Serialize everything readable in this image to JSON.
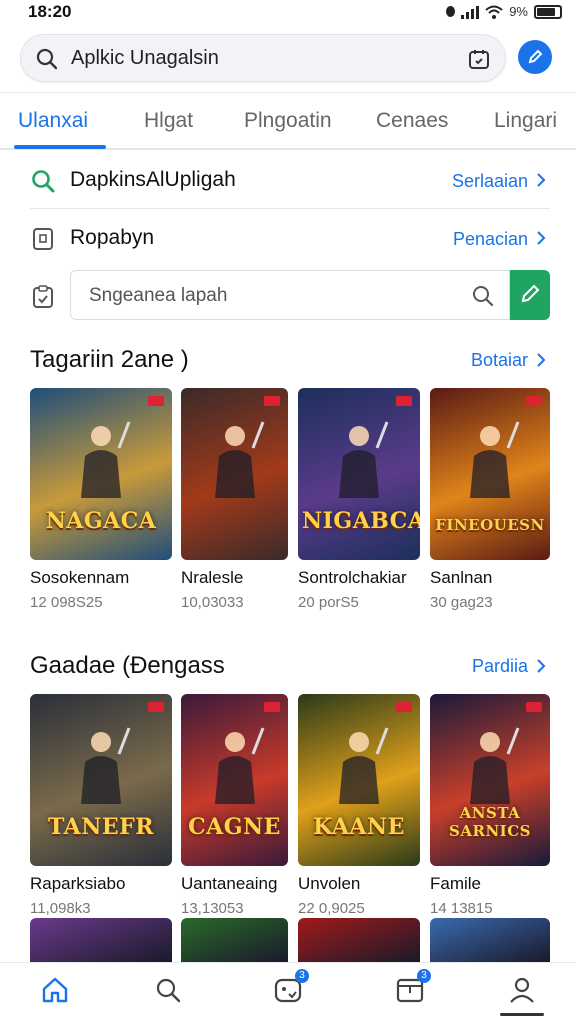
{
  "status_bar": {
    "time": "18:20",
    "battery": "9%"
  },
  "search": {
    "value": "Aplkic Unagalsin"
  },
  "tabs": [
    {
      "label": "Ulanxai",
      "active": true
    },
    {
      "label": "Hlgat",
      "active": false
    },
    {
      "label": "Plngoatin",
      "active": false
    },
    {
      "label": "Cenaes",
      "active": false
    },
    {
      "label": "Lingari",
      "active": false
    }
  ],
  "rows": [
    {
      "title": "DapkinsAlUpligah",
      "link": "Serlaaian",
      "icon": "search-icon"
    },
    {
      "title": "Ropabyn",
      "link": "Penacian",
      "icon": "tablet-icon"
    }
  ],
  "filter": {
    "placeholder": "Sngeanea lapah"
  },
  "sections": [
    {
      "title": "Tagariin 2ane )",
      "link": "Botaiar",
      "games": [
        {
          "name": "Sosokennam",
          "meta": "12 098S25",
          "art_title": "NAGACA",
          "colors": [
            "#1f4e7a",
            "#c89a3a"
          ]
        },
        {
          "name": "Nralesle",
          "meta": "10,03033",
          "art_title": "",
          "colors": [
            "#3a2a2a",
            "#a23a1a"
          ]
        },
        {
          "name": "Sontrolchakiar",
          "meta": "20 porS5",
          "art_title": "NIGABCA",
          "colors": [
            "#1c2f5a",
            "#5a3b8a"
          ]
        },
        {
          "name": "Sanlnan",
          "meta": "30 gag23",
          "art_title": "FINEOUESN",
          "colors": [
            "#5a1a14",
            "#e0841a"
          ]
        }
      ]
    },
    {
      "title": "Gaadae (Đengass",
      "link": "Pardiia",
      "games": [
        {
          "name": "Raparksiabo",
          "meta": "11,098k3",
          "art_title": "TANEFR",
          "colors": [
            "#2a2f3a",
            "#7a6a4a"
          ]
        },
        {
          "name": "Uantaneaing",
          "meta": "13,13053",
          "art_title": "CAGNE",
          "colors": [
            "#3a1a3a",
            "#c83a2a"
          ]
        },
        {
          "name": "Unvolen",
          "meta": "22 0,9025",
          "art_title": "KAANE",
          "colors": [
            "#2a3a1a",
            "#e0a01a"
          ]
        },
        {
          "name": "Famile",
          "meta": "14 13815",
          "art_title": "ANSTA SARNICS",
          "colors": [
            "#1a1a3a",
            "#c8402a"
          ]
        }
      ]
    }
  ],
  "peek_colors": [
    "#6a3a8a",
    "#2a6a2a",
    "#a01a1a",
    "#3a6ab0"
  ],
  "bottom_nav": [
    {
      "name": "home",
      "badge": ""
    },
    {
      "name": "search",
      "badge": ""
    },
    {
      "name": "games",
      "badge": "3"
    },
    {
      "name": "library",
      "badge": "3"
    },
    {
      "name": "profile",
      "badge": ""
    }
  ],
  "colors": {
    "accent": "#1a73e8",
    "green": "#1fa463"
  }
}
